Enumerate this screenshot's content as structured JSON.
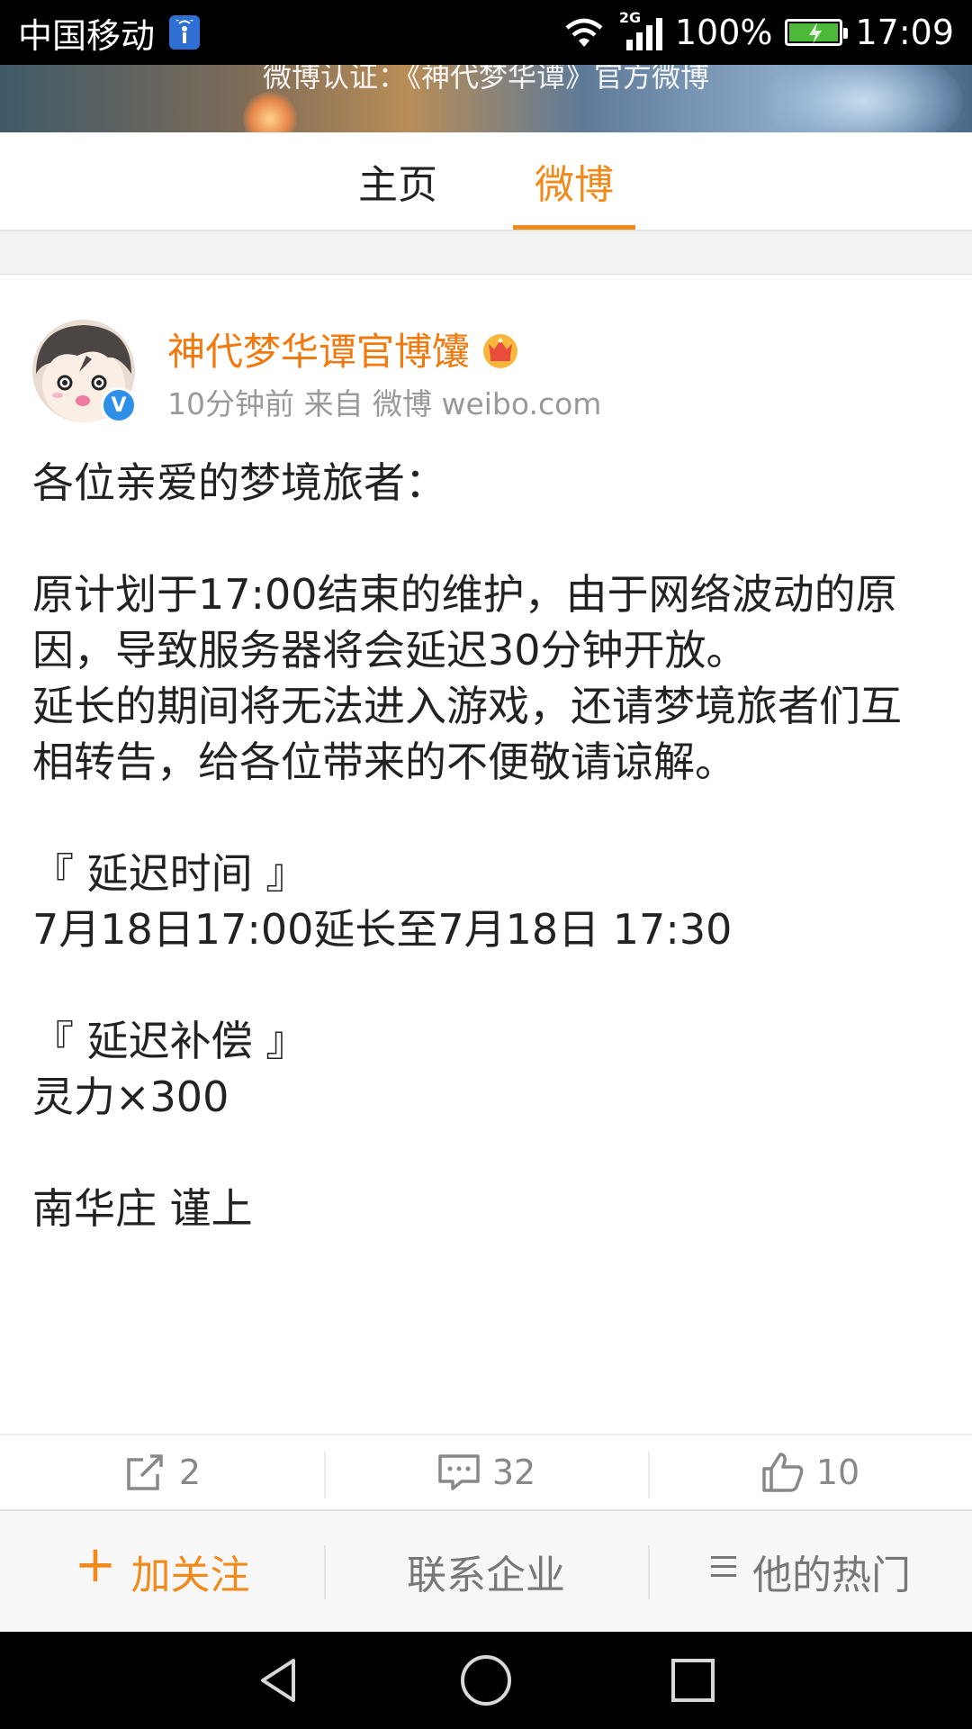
{
  "status": {
    "carrier": "中国移动",
    "network": "2G",
    "battery": "100%",
    "time": "17:09",
    "battery_level": 1.0
  },
  "banner": {
    "text": "微博认证：《神代梦华谭》官方微博"
  },
  "tabs": [
    {
      "label": "主页",
      "active": false
    },
    {
      "label": "微博",
      "active": true
    }
  ],
  "post": {
    "author": "神代梦华谭官博馕",
    "meta": "10分钟前 来自 微博 weibo.com",
    "verified_mark": "V",
    "body": "各位亲爱的梦境旅者：\n\n原计划于17:00结束的维护，由于网络波动的原因，导致服务器将会延迟30分钟开放。\n延长的期间将无法进入游戏，还请梦境旅者们互相转告，给各位带来的不便敬请谅解。\n\n『 延迟时间 』\n7月18日17:00延长至7月18日 17:30\n\n『 延迟补偿 』\n灵力×300\n\n南华庄 谨上"
  },
  "actions": {
    "repost_count": "2",
    "comment_count": "32",
    "like_count": "10"
  },
  "follow_bar": {
    "follow_label": "加关注",
    "contact_label": "联系企业",
    "hot_label": "他的热门"
  },
  "colors": {
    "accent": "#f08a1a",
    "author": "#f07a10",
    "verified": "#2e8fe8"
  }
}
